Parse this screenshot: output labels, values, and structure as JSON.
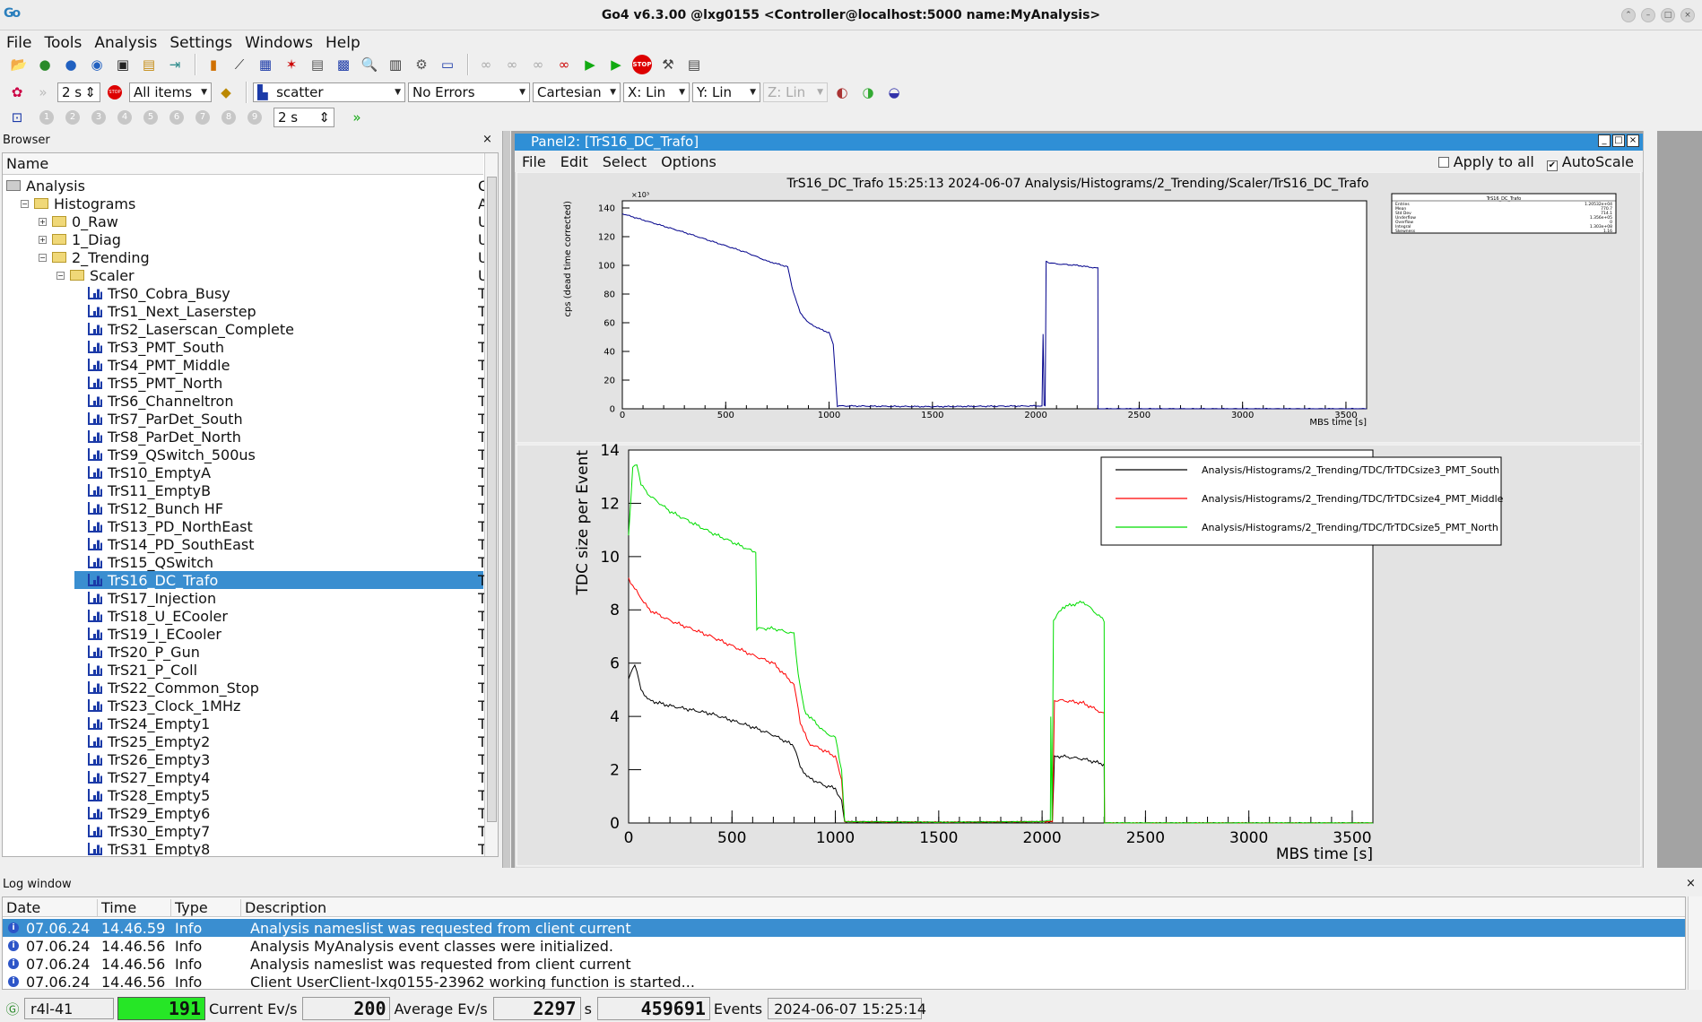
{
  "window": {
    "title": "Go4 v6.3.00 @lxg0155 <Controller@localhost:5000 name:MyAnalysis>",
    "app_icon": "Go"
  },
  "menubar": {
    "items": [
      "File",
      "Tools",
      "Analysis",
      "Settings",
      "Windows",
      "Help"
    ]
  },
  "toolbar2": {
    "interval": "2 s",
    "items_filter": "All items",
    "draw_style": "scatter",
    "errors": "No Errors",
    "coords": "Cartesian",
    "xscale": "X: Lin",
    "yscale": "Y: Lin",
    "zscale": "Z: Lin"
  },
  "toolbar3": {
    "numbers": [
      "1",
      "2",
      "3",
      "4",
      "5",
      "6",
      "7",
      "8",
      "9"
    ],
    "interval": "2 s"
  },
  "browser": {
    "title": "Browser",
    "close": "×",
    "column": "Name",
    "rows": [
      {
        "label": "Analysis",
        "depth": 0,
        "kind": "root",
        "col": "C"
      },
      {
        "label": "Histograms",
        "depth": 0,
        "kind": "folder",
        "exp": "−",
        "col": "A"
      },
      {
        "label": "0_Raw",
        "depth": 1,
        "kind": "folder",
        "exp": "+",
        "col": "U"
      },
      {
        "label": "1_Diag",
        "depth": 1,
        "kind": "folder",
        "exp": "+",
        "col": "U"
      },
      {
        "label": "2_Trending",
        "depth": 1,
        "kind": "folder",
        "exp": "−",
        "col": "U"
      },
      {
        "label": "Scaler",
        "depth": 2,
        "kind": "folder",
        "exp": "−",
        "col": "U"
      },
      {
        "label": "TrS0_Cobra_Busy",
        "depth": 3,
        "kind": "hist",
        "col": "T"
      },
      {
        "label": "TrS1_Next_Laserstep",
        "depth": 3,
        "kind": "hist",
        "col": "T"
      },
      {
        "label": "TrS2_Laserscan_Complete",
        "depth": 3,
        "kind": "hist",
        "col": "T"
      },
      {
        "label": "TrS3_PMT_South",
        "depth": 3,
        "kind": "hist",
        "col": "T"
      },
      {
        "label": "TrS4_PMT_Middle",
        "depth": 3,
        "kind": "hist",
        "col": "T"
      },
      {
        "label": "TrS5_PMT_North",
        "depth": 3,
        "kind": "hist",
        "col": "T"
      },
      {
        "label": "TrS6_Channeltron",
        "depth": 3,
        "kind": "hist",
        "col": "T"
      },
      {
        "label": "TrS7_ParDet_South",
        "depth": 3,
        "kind": "hist",
        "col": "T"
      },
      {
        "label": "TrS8_ParDet_North",
        "depth": 3,
        "kind": "hist",
        "col": "T"
      },
      {
        "label": "TrS9_QSwitch_500us",
        "depth": 3,
        "kind": "hist",
        "col": "T"
      },
      {
        "label": "TrS10_EmptyA",
        "depth": 3,
        "kind": "hist",
        "col": "T"
      },
      {
        "label": "TrS11_EmptyB",
        "depth": 3,
        "kind": "hist",
        "col": "T"
      },
      {
        "label": "TrS12_Bunch HF",
        "depth": 3,
        "kind": "hist",
        "col": "T"
      },
      {
        "label": "TrS13_PD_NorthEast",
        "depth": 3,
        "kind": "hist",
        "col": "T"
      },
      {
        "label": "TrS14_PD_SouthEast",
        "depth": 3,
        "kind": "hist",
        "col": "T"
      },
      {
        "label": "TrS15_QSwitch",
        "depth": 3,
        "kind": "hist",
        "col": "T"
      },
      {
        "label": "TrS16_DC_Trafo",
        "depth": 3,
        "kind": "hist",
        "col": "T",
        "selected": true
      },
      {
        "label": "TrS17_Injection",
        "depth": 3,
        "kind": "hist",
        "col": "T"
      },
      {
        "label": "TrS18_U_ECooler",
        "depth": 3,
        "kind": "hist",
        "col": "T"
      },
      {
        "label": "TrS19_I_ECooler",
        "depth": 3,
        "kind": "hist",
        "col": "T"
      },
      {
        "label": "TrS20_P_Gun",
        "depth": 3,
        "kind": "hist",
        "col": "T"
      },
      {
        "label": "TrS21_P_Coll",
        "depth": 3,
        "kind": "hist",
        "col": "T"
      },
      {
        "label": "TrS22_Common_Stop",
        "depth": 3,
        "kind": "hist",
        "col": "T"
      },
      {
        "label": "TrS23_Clock_1MHz",
        "depth": 3,
        "kind": "hist",
        "col": "T"
      },
      {
        "label": "TrS24_Empty1",
        "depth": 3,
        "kind": "hist",
        "col": "T"
      },
      {
        "label": "TrS25_Empty2",
        "depth": 3,
        "kind": "hist",
        "col": "T"
      },
      {
        "label": "TrS26_Empty3",
        "depth": 3,
        "kind": "hist",
        "col": "T"
      },
      {
        "label": "TrS27_Empty4",
        "depth": 3,
        "kind": "hist",
        "col": "T"
      },
      {
        "label": "TrS28_Empty5",
        "depth": 3,
        "kind": "hist",
        "col": "T"
      },
      {
        "label": "TrS29_Empty6",
        "depth": 3,
        "kind": "hist",
        "col": "T"
      },
      {
        "label": "TrS30_Empty7",
        "depth": 3,
        "kind": "hist",
        "col": "T"
      },
      {
        "label": "TrS31_Empty8",
        "depth": 3,
        "kind": "hist",
        "col": "T"
      }
    ]
  },
  "panel": {
    "title": "Panel2: [TrS16_DC_Trafo]",
    "menu": [
      "File",
      "Edit",
      "Select",
      "Options"
    ],
    "apply_all": "Apply to all",
    "autoscale": "AutoScale",
    "autoscale_checked": true
  },
  "chart_data": [
    {
      "type": "line",
      "title": "TrS16_DC_Trafo  15:25:13  2024-06-07  Analysis/Histograms/2_Trending/Scaler/TrS16_DC_Trafo",
      "xlabel": "MBS time [s]",
      "ylabel": "cps (dead time corrected)",
      "y_multiplier": "×10³",
      "xlim": [
        0,
        3600
      ],
      "ylim": [
        0,
        145
      ],
      "xticks": [
        0,
        500,
        1000,
        1500,
        2000,
        2500,
        3000,
        3500
      ],
      "yticks": [
        0,
        20,
        40,
        60,
        80,
        100,
        120,
        140
      ],
      "series": [
        {
          "color": "#00008b",
          "x": [
            0,
            300,
            600,
            700,
            800,
            820,
            860,
            900,
            950,
            1000,
            1020,
            1040,
            1500,
            2000,
            2030,
            2035,
            2040,
            2045,
            2050,
            2060,
            2100,
            2200,
            2300,
            2301,
            3600
          ],
          "y": [
            136,
            123,
            109,
            103,
            99,
            85,
            67,
            60,
            56,
            53,
            45,
            2,
            1.5,
            2,
            2,
            52,
            2,
            2,
            103,
            102,
            101,
            100,
            98,
            0,
            0
          ]
        }
      ],
      "stats_box": {
        "title": "TrS16_DC_Trafo",
        "labels": [
          "Entries",
          "Mean",
          "Std Dev",
          "Underflow",
          "Overflow",
          "Integral",
          "Skewness"
        ],
        "values": [
          "1.20532e+04",
          "770.7",
          "714.1",
          "1.356e+05",
          "0",
          "1.303e+08",
          "1.16"
        ]
      }
    },
    {
      "type": "line",
      "title": "",
      "xlabel": "MBS time [s]",
      "ylabel": "TDC size per Event",
      "xlim": [
        0,
        3600
      ],
      "ylim": [
        0,
        14
      ],
      "xticks": [
        0,
        500,
        1000,
        1500,
        2000,
        2500,
        3000,
        3500
      ],
      "yticks": [
        0,
        2,
        4,
        6,
        8,
        10,
        12,
        14
      ],
      "series": [
        {
          "name": "Analysis/Histograms/2_Trending/TDC/TrTDCsize3_PMT_South",
          "color": "#000000",
          "x": [
            0,
            30,
            60,
            100,
            200,
            400,
            600,
            700,
            800,
            830,
            870,
            950,
            1000,
            1030,
            1045,
            1500,
            2000,
            2050,
            2060,
            2100,
            2200,
            2300,
            2302,
            3600
          ],
          "y": [
            5.4,
            6.0,
            5.0,
            4.6,
            4.4,
            4.1,
            3.6,
            3.3,
            2.9,
            2.1,
            1.7,
            1.4,
            1.3,
            0.8,
            0.05,
            0.03,
            0.05,
            0.05,
            2.5,
            2.5,
            2.4,
            2.2,
            0,
            0
          ]
        },
        {
          "name": "Analysis/Histograms/2_Trending/TDC/TrTDCsize4_PMT_Middle",
          "color": "#ff0000",
          "x": [
            0,
            20,
            100,
            200,
            400,
            600,
            700,
            800,
            830,
            870,
            950,
            1000,
            1030,
            1045,
            1500,
            2000,
            2050,
            2060,
            2100,
            2200,
            2300,
            2302,
            3600
          ],
          "y": [
            9.2,
            8.9,
            8.0,
            7.6,
            7.0,
            6.3,
            6.0,
            5.2,
            3.8,
            3.0,
            2.7,
            2.5,
            1.6,
            0.05,
            0.03,
            0.05,
            0.05,
            4.6,
            4.6,
            4.5,
            4.1,
            0,
            0
          ]
        },
        {
          "name": "Analysis/Histograms/2_Trending/TDC/TrTDCsize5_PMT_North",
          "color": "#00dd00",
          "x": [
            0,
            20,
            40,
            60,
            100,
            200,
            400,
            600,
            615,
            620,
            700,
            800,
            820,
            850,
            950,
            1000,
            1030,
            1045,
            1500,
            2000,
            2040,
            2042,
            2048,
            2055,
            2100,
            2200,
            2300,
            2302,
            3600
          ],
          "y": [
            10.8,
            13.3,
            13.5,
            12.7,
            12.3,
            11.7,
            10.9,
            10.2,
            10.2,
            7.3,
            7.3,
            7.1,
            5.6,
            4.2,
            3.4,
            3.2,
            2.0,
            0.05,
            0.03,
            0.05,
            0.1,
            4.0,
            0.1,
            7.6,
            8.1,
            8.3,
            7.6,
            0,
            0
          ]
        }
      ]
    }
  ],
  "log": {
    "title": "Log window",
    "close": "×",
    "headers": [
      "Date",
      "Time",
      "Type",
      "Description"
    ],
    "rows": [
      {
        "date": "07.06.24",
        "time": "14.46.59",
        "type": "Info",
        "desc": "Analysis nameslist was requested from client current",
        "selected": true
      },
      {
        "date": "07.06.24",
        "time": "14.46.56",
        "type": "Info",
        "desc": "Analysis MyAnalysis event classes were initialized."
      },
      {
        "date": "07.06.24",
        "time": "14.46.56",
        "type": "Info",
        "desc": "Analysis nameslist was requested from client current"
      },
      {
        "date": "07.06.24",
        "time": "14.46.56",
        "type": "Info",
        "desc": "Client UserClient-lxg0155-23962 working function is started..."
      }
    ]
  },
  "status": {
    "node": "r4l-41",
    "rate": "191",
    "current_label": "Current Ev/s",
    "current_value": "200",
    "average_label": "Average Ev/s",
    "average_value": "2297",
    "seconds_unit": "s",
    "events_value": "459691",
    "events_label": "Events",
    "timestamp": "2024-06-07 15:25:14"
  }
}
